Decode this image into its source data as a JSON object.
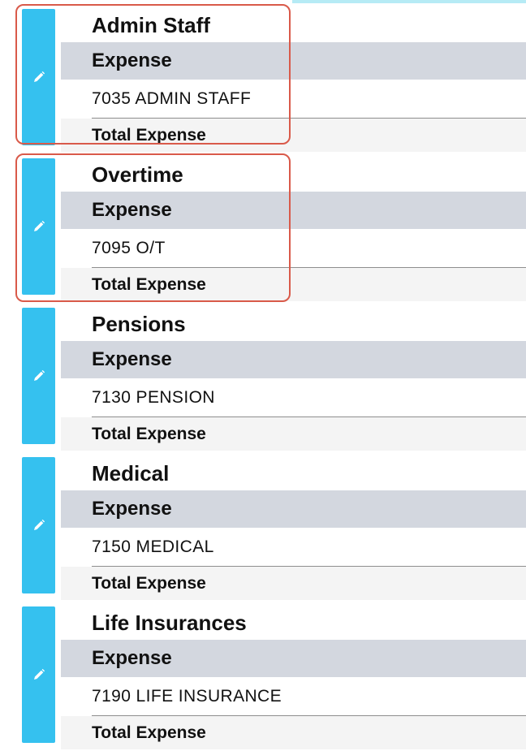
{
  "colors": {
    "edit_button": "#35c1ef",
    "expense_header_bg": "#d3d7df",
    "total_row_bg": "#f4f4f4",
    "highlight_border": "#d95a4a"
  },
  "groups": [
    {
      "title": "Admin Staff",
      "section_label": "Expense",
      "account": "7035 ADMIN STAFF",
      "total_label": "Total Expense",
      "edit_icon": "pencil-icon",
      "highlighted": true
    },
    {
      "title": "Overtime",
      "section_label": "Expense",
      "account": "7095 O/T",
      "total_label": "Total Expense",
      "edit_icon": "pencil-icon",
      "highlighted": true
    },
    {
      "title": "Pensions",
      "section_label": "Expense",
      "account": "7130 PENSION",
      "total_label": "Total Expense",
      "edit_icon": "pencil-icon",
      "highlighted": false
    },
    {
      "title": "Medical",
      "section_label": "Expense",
      "account": "7150 MEDICAL",
      "total_label": "Total Expense",
      "edit_icon": "pencil-icon",
      "highlighted": false
    },
    {
      "title": "Life Insurances",
      "section_label": "Expense",
      "account": "7190 LIFE INSURANCE",
      "total_label": "Total Expense",
      "edit_icon": "pencil-icon",
      "highlighted": false
    }
  ]
}
